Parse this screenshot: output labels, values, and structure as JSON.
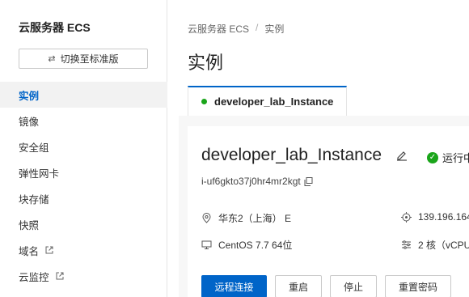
{
  "sidebar": {
    "title": "云服务器 ECS",
    "switch_label": "切换至标准版",
    "items": [
      {
        "label": "实例",
        "active": true
      },
      {
        "label": "镜像"
      },
      {
        "label": "安全组"
      },
      {
        "label": "弹性网卡"
      },
      {
        "label": "块存储"
      },
      {
        "label": "快照"
      },
      {
        "label": "域名",
        "external": true
      },
      {
        "label": "云监控",
        "external": true
      }
    ]
  },
  "breadcrumb": [
    "云服务器 ECS",
    "实例"
  ],
  "page_title": "实例",
  "tab": {
    "label": "developer_lab_Instance",
    "status_color": "#1aa51a"
  },
  "instance": {
    "name": "developer_lab_Instance",
    "status": "运行中",
    "id": "i-uf6gkto37j0hr4mr2kgt",
    "region": "华东2（上海） E",
    "ip": "139.196.164",
    "os": "CentOS 7.7 64位",
    "cpu": "2 核（vCPU"
  },
  "actions": {
    "remote": "远程连接",
    "restart": "重启",
    "stop": "停止",
    "reset_password": "重置密码"
  },
  "colors": {
    "accent": "#0064c8",
    "running": "#1aa51a"
  }
}
